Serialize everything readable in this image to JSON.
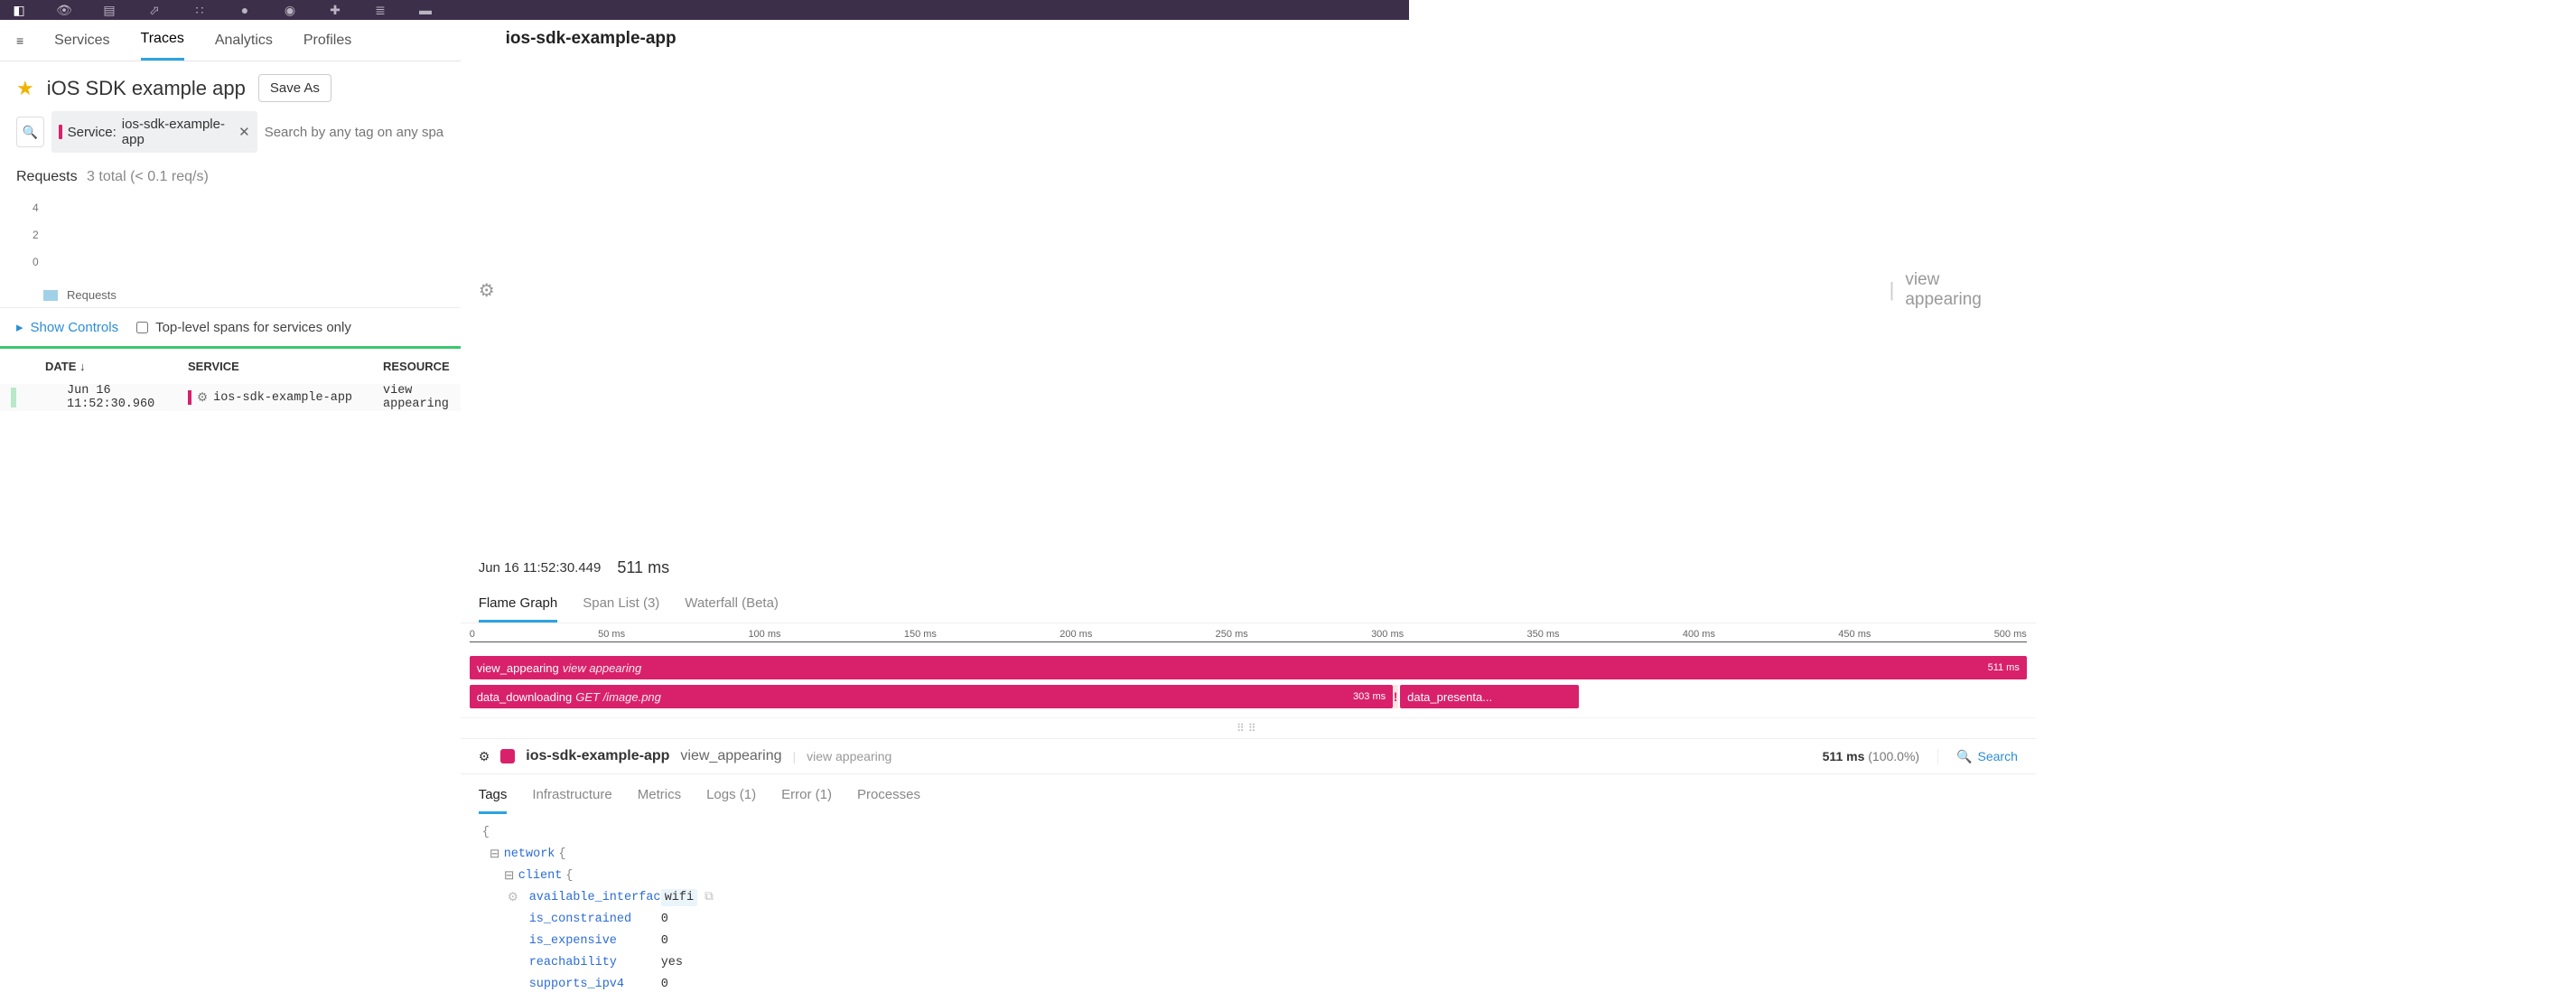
{
  "topnav_icons": [
    "dog-logo",
    "binoculars",
    "news",
    "chart-line",
    "scatter",
    "alert",
    "gauge",
    "puzzle",
    "indent",
    "book"
  ],
  "subnav": {
    "tabs": [
      "Services",
      "Traces",
      "Analytics",
      "Profiles"
    ],
    "active": 1
  },
  "left": {
    "title": "iOS SDK example app",
    "save_as": "Save As",
    "filter_chip_key": "Service:",
    "filter_chip_value": "ios-sdk-example-app",
    "search_placeholder": "Search by any tag on any span",
    "requests_label": "Requests",
    "requests_sub": "3 total (< 0.1 req/s)",
    "yticks": [
      "4",
      "2",
      "0"
    ],
    "legend": "Requests",
    "show_controls": "Show Controls",
    "checkbox_label": "Top-level spans for services only",
    "columns": {
      "date": "DATE ↓",
      "service": "SERVICE",
      "resource": "RESOURCE"
    },
    "row": {
      "date": "Jun 16 11:52:30.960",
      "service": "ios-sdk-example-app",
      "resource": "view appearing"
    }
  },
  "right": {
    "header": {
      "app": "ios-sdk-example-app",
      "op": "view appearing",
      "timestamp": "Jun 16 11:52:30.449",
      "duration": "511 ms"
    },
    "ftabs": [
      "Flame Graph",
      "Span List (3)",
      "Waterfall (Beta)"
    ],
    "ruler": [
      "0",
      "50 ms",
      "100 ms",
      "150 ms",
      "200 ms",
      "250 ms",
      "300 ms",
      "350 ms",
      "400 ms",
      "450 ms",
      "500 ms"
    ],
    "spans": {
      "root": {
        "name": "view_appearing",
        "resource": "view appearing",
        "dur": "511 ms"
      },
      "download": {
        "name": "data_downloading",
        "resource": "GET /image.png",
        "dur": "303 ms"
      },
      "present": {
        "name": "data_presenta..."
      }
    },
    "span_detail": {
      "app": "ios-sdk-example-app",
      "op": "view_appearing",
      "res": "view appearing",
      "dur": "511 ms",
      "pct": "(100.0%)",
      "search": "Search"
    },
    "mtabs": [
      "Tags",
      "Infrastructure",
      "Metrics",
      "Logs (1)",
      "Error (1)",
      "Processes"
    ],
    "tags": {
      "network_key": "network",
      "client_key": "client",
      "rows": [
        {
          "k": "available_interfaces",
          "v": "wifi",
          "hl": true
        },
        {
          "k": "is_constrained",
          "v": "0"
        },
        {
          "k": "is_expensive",
          "v": "0"
        },
        {
          "k": "reachability",
          "v": "yes"
        },
        {
          "k": "supports_ipv4",
          "v": "0"
        }
      ]
    }
  }
}
